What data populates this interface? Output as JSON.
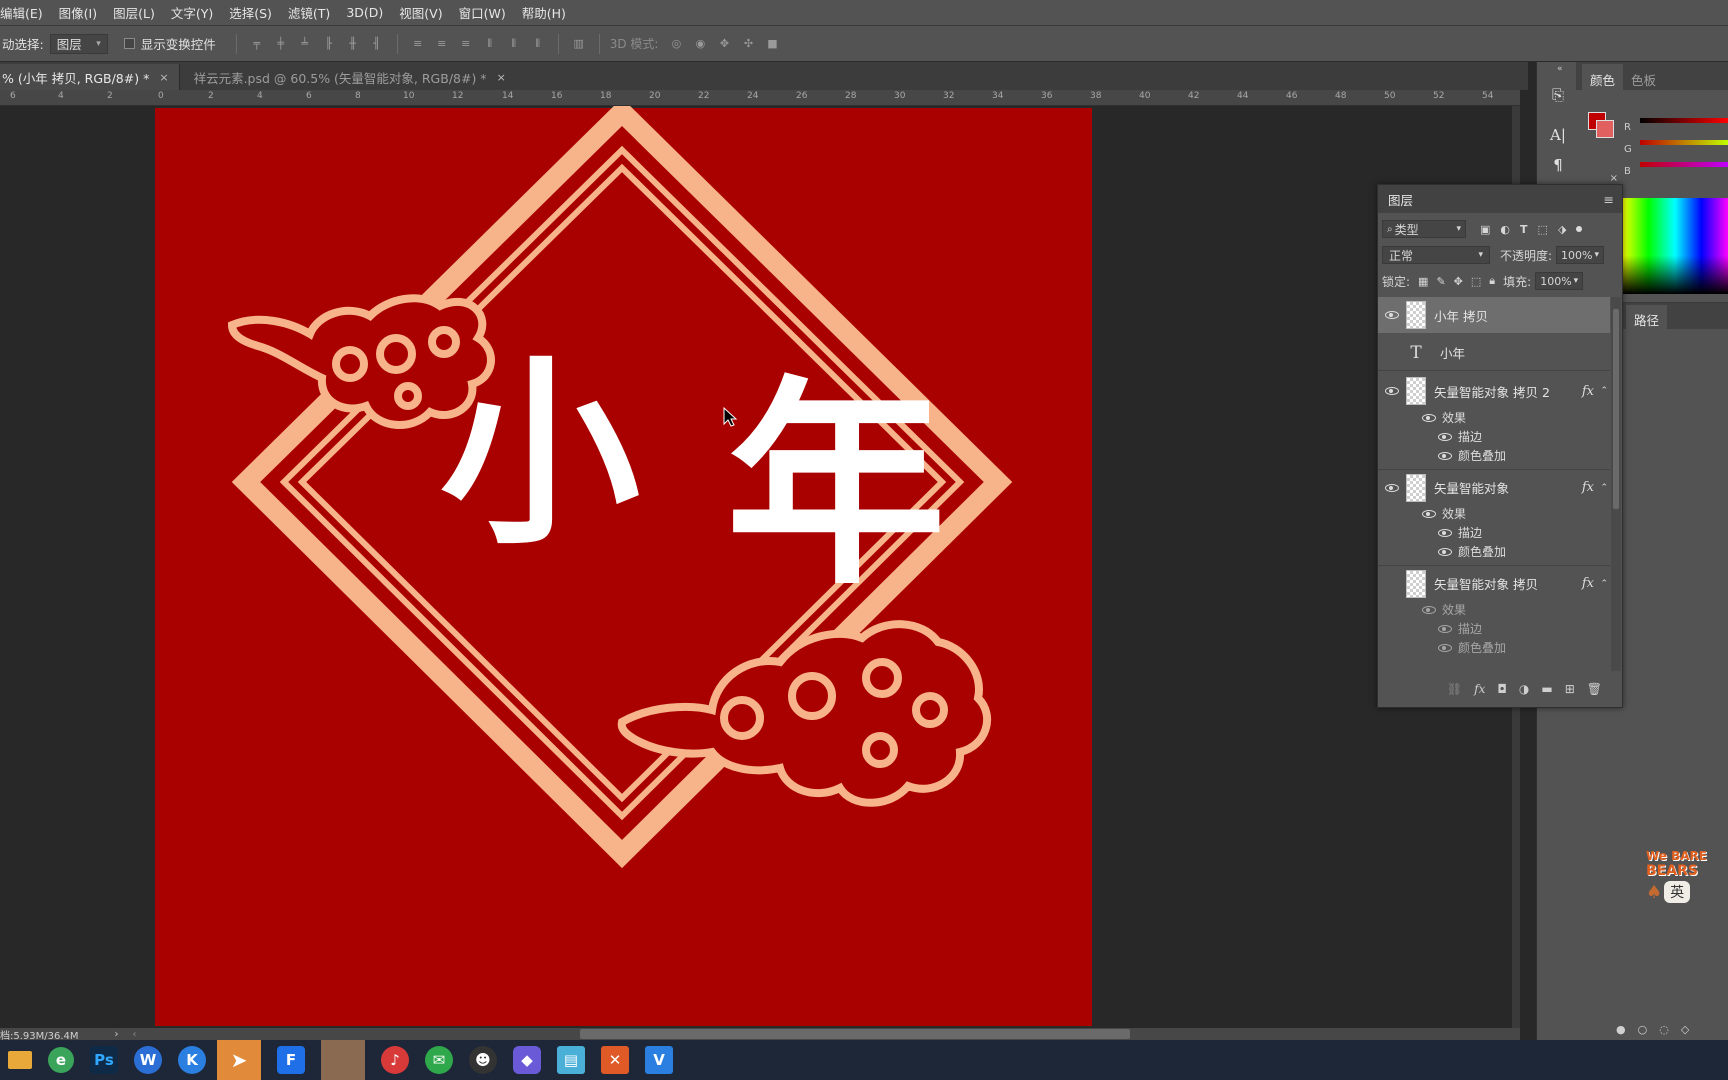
{
  "menu": [
    "编辑(E)",
    "图像(I)",
    "图层(L)",
    "文字(Y)",
    "选择(S)",
    "滤镜(T)",
    "3D(D)",
    "视图(V)",
    "窗口(W)",
    "帮助(H)"
  ],
  "options": {
    "auto_select_label": "动选择:",
    "auto_select_value": "图层",
    "show_transform_label": "显示变换控件",
    "mode_3d_label": "3D 模式:"
  },
  "tabs": [
    {
      "label": "% (小年 拷贝, RGB/8#) *",
      "close": "×"
    },
    {
      "label": "祥云元素.psd @ 60.5% (矢量智能对象, RGB/8#) *",
      "close": "×"
    }
  ],
  "ruler": [
    "6",
    "4",
    "2",
    "0",
    "2",
    "4",
    "6",
    "8",
    "10",
    "12",
    "14",
    "16",
    "18",
    "20",
    "22",
    "24",
    "26",
    "28",
    "30",
    "32",
    "34",
    "36",
    "38",
    "40",
    "42",
    "44",
    "46",
    "48",
    "50",
    "52",
    "54"
  ],
  "canvas": {
    "background": "#a90000",
    "frame_color": "#f7b48a",
    "title_chars": [
      "小",
      "年"
    ],
    "text_color": "#ffffff"
  },
  "color_panel": {
    "tabs": [
      "颜色",
      "色板"
    ],
    "channels": [
      "R",
      "G",
      "B"
    ],
    "foreground": "#c00000"
  },
  "path_panel": {
    "tab": "路径"
  },
  "layers_panel": {
    "title": "图层",
    "filter_value": "类型",
    "blend_mode": "正常",
    "opacity_label": "不透明度:",
    "opacity_value": "100%",
    "lock_label": "锁定:",
    "fill_label": "填充:",
    "fill_value": "100%",
    "layers": [
      {
        "name": "小年 拷贝",
        "visible": true,
        "kind": "image",
        "selected": true
      },
      {
        "name": "小年",
        "visible": false,
        "kind": "text"
      },
      {
        "name": "矢量智能对象 拷贝 2",
        "visible": true,
        "kind": "smart",
        "fx": "fx",
        "effects_label": "效果",
        "effects": [
          "描边",
          "颜色叠加"
        ]
      },
      {
        "name": "矢量智能对象",
        "visible": true,
        "kind": "smart",
        "fx": "fx",
        "effects_label": "效果",
        "effects": [
          "描边",
          "颜色叠加"
        ]
      },
      {
        "name": "矢量智能对象 拷贝",
        "visible": false,
        "kind": "smart",
        "fx": "fx",
        "effects_label": "效果",
        "effects": [
          "描边",
          "颜色叠加"
        ]
      }
    ]
  },
  "status": {
    "doc_size": "档:5.93M/36.4M"
  },
  "sticker": {
    "line1": "We BARE",
    "line2": "BEARS",
    "char": "英"
  },
  "taskbar": [
    {
      "name": "file-explorer",
      "label": "",
      "color": "#e8a93a"
    },
    {
      "name": "browser-360",
      "label": "e",
      "color": "#3aa55a"
    },
    {
      "name": "photoshop",
      "label": "Ps",
      "color": "#0e2a47"
    },
    {
      "name": "word-app",
      "label": "W",
      "color": "#2b6fd6"
    },
    {
      "name": "k-app",
      "label": "K",
      "color": "#2a7fe0"
    },
    {
      "name": "feishu",
      "label": "",
      "color": "#3a8ef0"
    },
    {
      "name": "f-app",
      "label": "F",
      "color": "#1e6fe8"
    },
    {
      "name": "image-viewer",
      "label": "",
      "color": "#8a6a50"
    },
    {
      "name": "netease-music",
      "label": "",
      "color": "#d83a3a"
    },
    {
      "name": "wechat",
      "label": "",
      "color": "#2ea84a"
    },
    {
      "name": "qq",
      "label": "",
      "color": "#333333"
    },
    {
      "name": "gem-app",
      "label": "",
      "color": "#6a5ad8"
    },
    {
      "name": "notes-app",
      "label": "",
      "color": "#4ab0d8"
    },
    {
      "name": "x-app",
      "label": "",
      "color": "#e05a28"
    },
    {
      "name": "vip-app",
      "label": "",
      "color": "#2a7fe0"
    }
  ]
}
